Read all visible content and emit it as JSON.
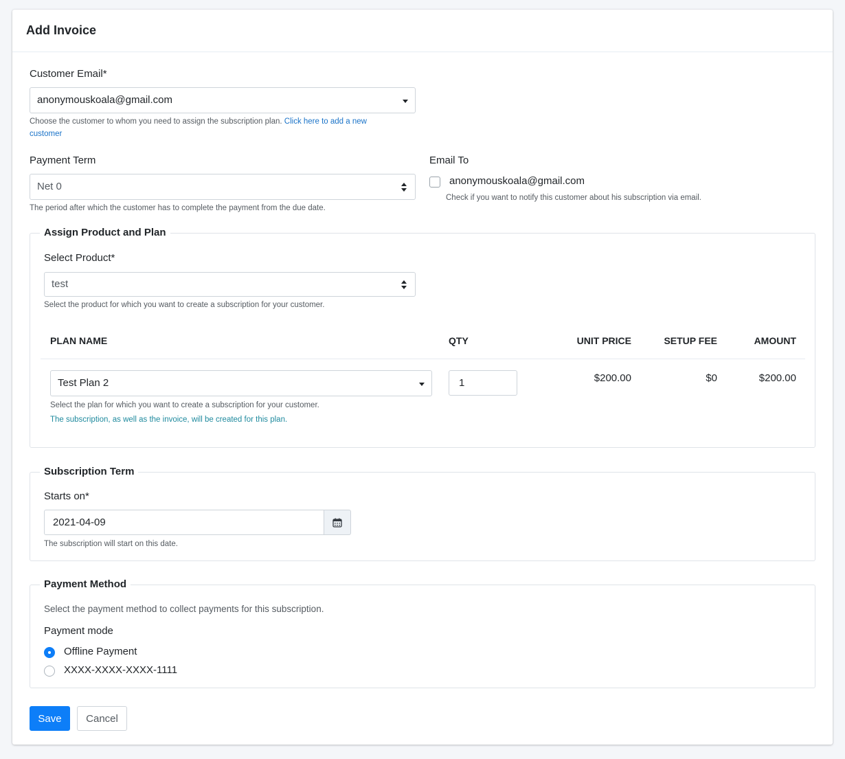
{
  "header": {
    "title": "Add Invoice"
  },
  "customer": {
    "label": "Customer Email*",
    "value": "anonymouskoala@gmail.com",
    "help": "Choose the customer to whom you need to assign the subscription plan.",
    "help_link_line1": "Click here to add a new",
    "help_link_line2": "customer"
  },
  "payment_term": {
    "label": "Payment Term",
    "value": "Net 0",
    "help": "The period after which the customer has to complete the payment from the due date."
  },
  "email_to": {
    "label": "Email To",
    "checkbox_label": "anonymouskoala@gmail.com",
    "checked": false,
    "help": "Check if you want to notify this customer about his subscription via email."
  },
  "product_plan": {
    "legend": "Assign Product and Plan",
    "product_label": "Select Product*",
    "product_value": "test",
    "product_help": "Select the product for which you want to create a subscription for your customer.",
    "table": {
      "headers": [
        "PLAN NAME",
        "QTY",
        "UNIT PRICE",
        "SETUP FEE",
        "AMOUNT"
      ],
      "row": {
        "plan": "Test Plan 2",
        "qty": "1",
        "unit_price": "$200.00",
        "setup_fee": "$0",
        "amount": "$200.00"
      }
    },
    "plan_help": "Select the plan for which you want to create a subscription for your customer.",
    "plan_note": "The subscription, as well as the invoice, will be created for this plan."
  },
  "subscription_term": {
    "legend": "Subscription Term",
    "starts_label": "Starts on*",
    "starts_value": "2021-04-09",
    "help": "The subscription will start on this date."
  },
  "payment_method": {
    "legend": "Payment Method",
    "description": "Select the payment method to collect payments for this subscription.",
    "mode_label": "Payment mode",
    "options": [
      {
        "label": "Offline Payment",
        "selected": true
      },
      {
        "label": "XXXX-XXXX-XXXX-1111",
        "selected": false
      }
    ]
  },
  "actions": {
    "save": "Save",
    "cancel": "Cancel"
  },
  "colors": {
    "primary": "#0d7ef8",
    "link": "#1a73c8",
    "note": "#1f8a9e"
  }
}
